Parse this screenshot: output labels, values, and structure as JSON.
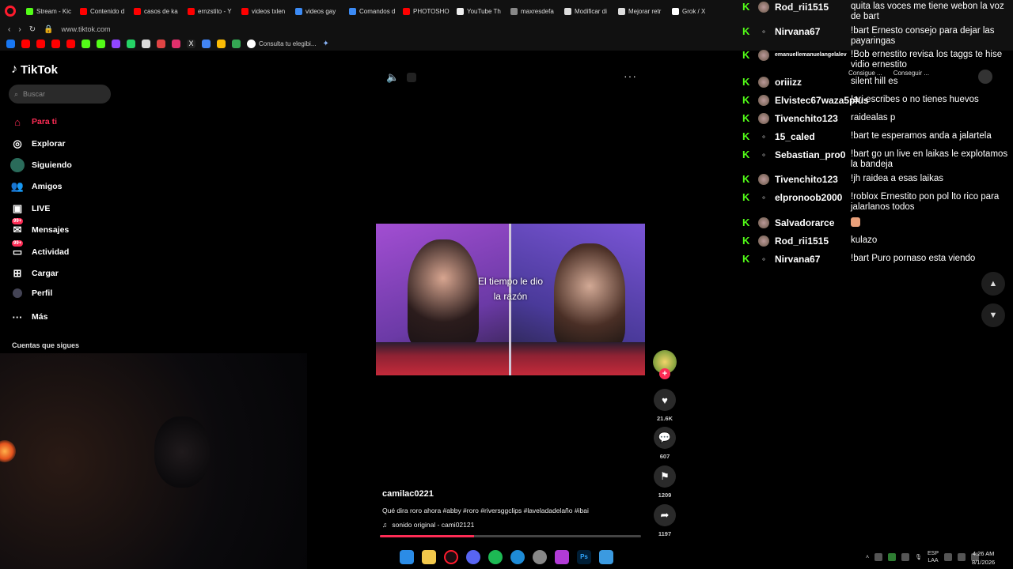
{
  "browser": {
    "tabs": [
      {
        "label": "Stream - Kic",
        "color": "#53fc18"
      },
      {
        "label": "Contenido d",
        "color": "#ff0000"
      },
      {
        "label": "casos de ka",
        "color": "#ff0000"
      },
      {
        "label": "ernzstito - Y",
        "color": "#ff0000"
      },
      {
        "label": "videos txlen",
        "color": "#ff0000"
      },
      {
        "label": "videos gay",
        "color": "#3c8bf5"
      },
      {
        "label": "Comandos d",
        "color": "#3c8bf5"
      },
      {
        "label": "PHOTOSHO",
        "color": "#ff0000"
      },
      {
        "label": "YouTube Th",
        "color": "#eeeeee"
      },
      {
        "label": "maxresdefa",
        "color": "#888888"
      },
      {
        "label": "Modificar di",
        "color": "#dddddd"
      },
      {
        "label": "Mejorar retr",
        "color": "#dddddd"
      },
      {
        "label": "Grok / X",
        "color": "#ffffff"
      }
    ],
    "url": "www.tiktok.com",
    "bookmark_link": "Consulta tu elegibi..."
  },
  "tiktok": {
    "brand": "TikTok",
    "search_placeholder": "Buscar",
    "nav": [
      {
        "label": "Para ti",
        "icon": "home-icon",
        "glyph": "⌂"
      },
      {
        "label": "Explorar",
        "icon": "compass-icon",
        "glyph": "◎"
      },
      {
        "label": "Siguiendo",
        "icon": "following-avatar-icon",
        "glyph": "●"
      },
      {
        "label": "Amigos",
        "icon": "friends-icon",
        "glyph": "👥"
      },
      {
        "label": "LIVE",
        "icon": "live-icon",
        "glyph": "▣"
      },
      {
        "label": "Mensajes",
        "icon": "messages-icon",
        "glyph": "✉",
        "badge": "99+"
      },
      {
        "label": "Actividad",
        "icon": "activity-icon",
        "glyph": "▭",
        "badge": "99+"
      },
      {
        "label": "Cargar",
        "icon": "upload-icon",
        "glyph": "⊞"
      },
      {
        "label": "Perfil",
        "icon": "profile-icon",
        "glyph": "●"
      },
      {
        "label": "Más",
        "icon": "more-icon",
        "glyph": "···"
      }
    ],
    "following_header": "Cuentas que sigues",
    "video": {
      "caption_line1": "El tiempo le dio",
      "caption_line2": "la razón",
      "author": "camilac0221",
      "description": "Qué dira roro ahora #abby #roro #riversggclips #laveladadelaño #ibai",
      "sound": "sonido original - cami02121",
      "progress": 0.36
    },
    "actions": {
      "likes": "21.6K",
      "comments": "607",
      "saves": "1209",
      "shares": "1197"
    }
  },
  "chat": {
    "messages": [
      {
        "user": "Rod_rii1515",
        "text": "quita las voces me tiene webon la voz de bart",
        "avatar": "img"
      },
      {
        "user": "Nirvana67",
        "text": "!bart Ernesto consejo para dejar las payaringas",
        "avatar": "default"
      },
      {
        "user": "emanuellemanuelangelalev",
        "text": "!Bob ernestito revisa los taggs te hise vidio ernestito",
        "avatar": "img",
        "small": true
      },
      {
        "user": "oriiizz",
        "text": "silent hill es",
        "avatar": "img"
      },
      {
        "user": "Elvistec67waza5plus",
        "text": "!ari escribes o no tienes huevos",
        "avatar": "img"
      },
      {
        "user": "Tivenchito123",
        "text": "raidealas p",
        "avatar": "img"
      },
      {
        "user": "15_caled",
        "text": "!bart te esperamos anda a jalartela",
        "avatar": "default"
      },
      {
        "user": "Sebastian_pro0",
        "text": "!bart go un live en laikas le explotamos la bandeja",
        "avatar": "default"
      },
      {
        "user": "Tivenchito123",
        "text": "!jh raidea a esas laikas",
        "avatar": "img"
      },
      {
        "user": "elpronoob2000",
        "text": "!roblox Ernestito pon pol lto rico para jalarlanos todos",
        "avatar": "default"
      },
      {
        "user": "Salvadorarce",
        "text": "",
        "avatar": "img",
        "emoji": true
      },
      {
        "user": "Rod_rii1515",
        "text": "kulazo",
        "avatar": "img"
      },
      {
        "user": "Nirvana67",
        "text": "!bart Puro pornaso esta viendo",
        "avatar": "default"
      }
    ],
    "subtabs": [
      "Consigue ...",
      "Conseguir ..."
    ]
  },
  "taskbar": {
    "lang_line1": "ESP",
    "lang_line2": "LAA",
    "time": "4:26 AM",
    "date": "8/1/2026"
  }
}
